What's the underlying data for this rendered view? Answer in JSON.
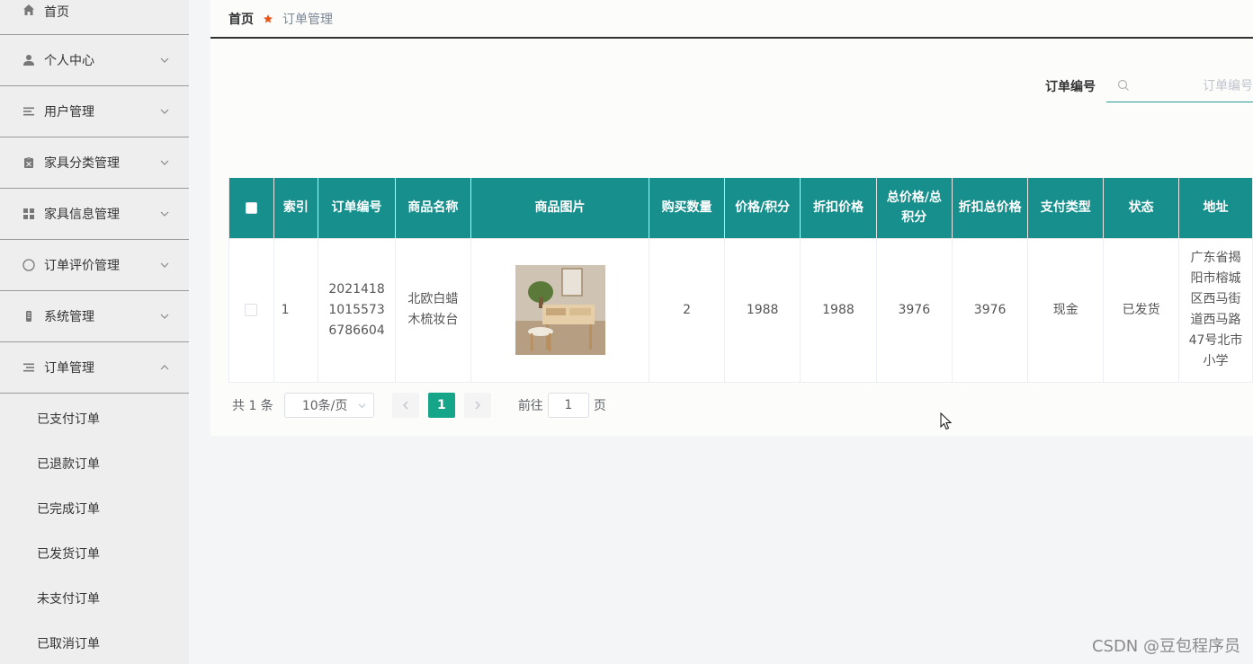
{
  "sidebar": {
    "items": [
      {
        "label": "首页",
        "icon": "home-icon"
      },
      {
        "label": "个人中心",
        "icon": "user-icon"
      },
      {
        "label": "用户管理",
        "icon": "list-icon"
      },
      {
        "label": "家具分类管理",
        "icon": "clipboard-icon"
      },
      {
        "label": "家具信息管理",
        "icon": "grid-icon"
      },
      {
        "label": "订单评价管理",
        "icon": "compass-icon"
      },
      {
        "label": "系统管理",
        "icon": "device-icon"
      },
      {
        "label": "订单管理",
        "icon": "list-icon"
      }
    ],
    "submenu": [
      "已支付订单",
      "已退款订单",
      "已完成订单",
      "已发货订单",
      "未支付订单",
      "已取消订单"
    ]
  },
  "breadcrumb": {
    "home": "首页",
    "current": "订单管理"
  },
  "search": {
    "label": "订单编号",
    "placeholder": "订单编号"
  },
  "table": {
    "headers": [
      "索引",
      "订单编号",
      "商品名称",
      "商品图片",
      "购买数量",
      "价格/积分",
      "折扣价格",
      "总价格/总积分",
      "折扣总价格",
      "支付类型",
      "状态",
      "地址"
    ],
    "rows": [
      {
        "index": "1",
        "order_no": "20214181015573 6786604",
        "order_no_lines": [
          "2021418",
          "1015573",
          "6786604"
        ],
        "product_name_lines": [
          "北欧白蜡",
          "木梳妆台"
        ],
        "quantity": "2",
        "price": "1988",
        "discount_price": "1988",
        "total_price": "3976",
        "discount_total": "3976",
        "pay_type": "现金",
        "status": "已发货",
        "address_lines": [
          "广东省揭",
          "阳市榕城",
          "区西马街",
          "道西马路",
          "47号北市",
          "小学"
        ]
      }
    ]
  },
  "pagination": {
    "total": "共 1 条",
    "page_size": "10条/页",
    "current": "1",
    "goto_prefix": "前往",
    "goto_value": "1",
    "goto_suffix": "页"
  },
  "watermark": "CSDN @豆包程序员",
  "colors": {
    "table_header": "#17908d",
    "active_page": "#17a589",
    "breadcrumb_star": "#e8561b"
  }
}
